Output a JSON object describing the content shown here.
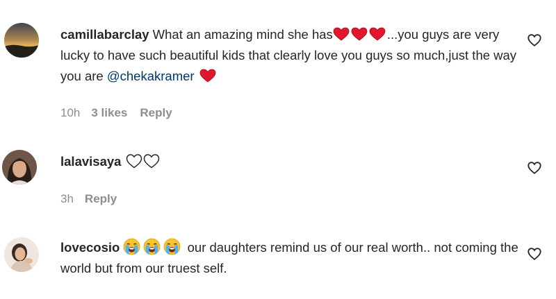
{
  "comments": [
    {
      "username": "camillabarclay",
      "text_before": "What an amazing mind she has",
      "text_after": "...you guys are very lucky to have such beautiful kids that clearly love you guys so much,just the way you are ",
      "mention": "@chekakramer",
      "time": "10h",
      "likes": "3 likes",
      "reply": "Reply"
    },
    {
      "username": "lalavisaya",
      "time": "3h",
      "reply": "Reply"
    },
    {
      "username": "lovecosio",
      "text": "our daughters remind us of our real worth.. not coming the world but from our truest self."
    }
  ],
  "colors": {
    "heart_red": "#e0182d",
    "mention": "#00376b",
    "meta_gray": "#8e8e8e",
    "emoji_yellow": "#f7c330",
    "tear_blue": "#4fb3f0"
  },
  "icons": [
    "red-heart-emoji",
    "white-heart-emoji",
    "loudly-crying-face-emoji",
    "heart-outline-icon"
  ]
}
